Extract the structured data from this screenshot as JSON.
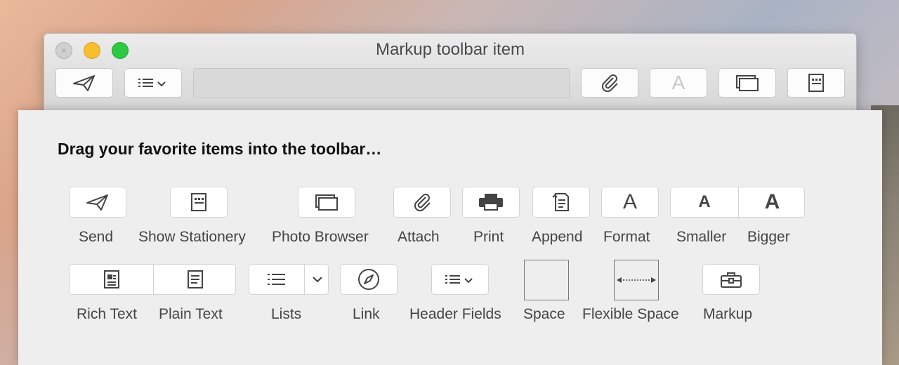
{
  "window": {
    "title": "Markup toolbar item",
    "toolbar": [
      {
        "name": "send",
        "icon": "paper-plane-icon"
      },
      {
        "name": "header-fields",
        "icon": "list-chevron-icon"
      },
      {
        "name": "attach",
        "icon": "paperclip-icon"
      },
      {
        "name": "format",
        "icon": "font-a-icon",
        "glyph": "A"
      },
      {
        "name": "photo-browser",
        "icon": "photo-stack-icon"
      },
      {
        "name": "show-stationery",
        "icon": "stationery-icon"
      }
    ]
  },
  "sheet": {
    "heading": "Drag your favorite items into the toolbar…",
    "row1": [
      {
        "label": "Send",
        "icon": "paper-plane-icon"
      },
      {
        "label": "Show Stationery",
        "icon": "stationery-icon"
      },
      {
        "label": "Photo Browser",
        "icon": "photo-stack-icon"
      },
      {
        "label": "Attach",
        "icon": "paperclip-icon"
      },
      {
        "label": "Print",
        "icon": "printer-icon"
      },
      {
        "label": "Append",
        "icon": "append-icon"
      },
      {
        "label": "Format",
        "icon": "font-a-icon",
        "glyph": "A"
      },
      {
        "label": "Smaller",
        "icon": "font-smaller-icon",
        "glyph": "A"
      },
      {
        "label": "Bigger",
        "icon": "font-bigger-icon",
        "glyph": "A"
      }
    ],
    "row2": [
      {
        "label": "Rich Text",
        "icon": "rich-text-icon"
      },
      {
        "label": "Plain Text",
        "icon": "plain-text-icon"
      },
      {
        "label": "Lists",
        "icon": "list-icon"
      },
      {
        "label": "Link",
        "icon": "compass-icon"
      },
      {
        "label": "Header Fields",
        "icon": "list-chevron-icon"
      },
      {
        "label": "Space",
        "icon": "space-box"
      },
      {
        "label": "Flexible Space",
        "icon": "flexible-space-arrow-icon"
      },
      {
        "label": "Markup",
        "icon": "toolbox-icon"
      }
    ]
  }
}
